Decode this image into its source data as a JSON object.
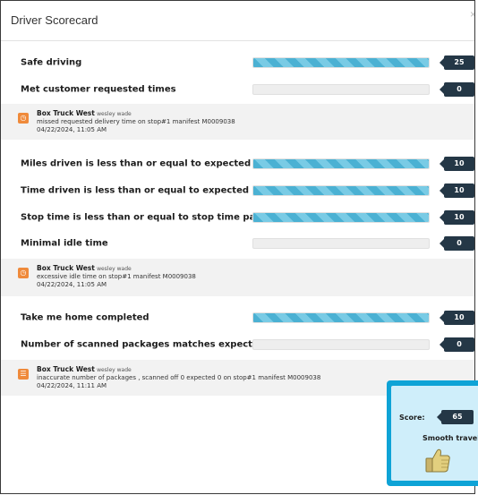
{
  "dialog": {
    "title": "Driver Scorecard",
    "close_glyph": "×"
  },
  "metrics": [
    {
      "label": "Safe driving",
      "value": "25",
      "fill": 1.0
    },
    {
      "label": "Met customer requested times",
      "value": "0",
      "fill": 0
    },
    {
      "label": "Miles driven is less than or equal to expected",
      "value": "10",
      "fill": 1.0
    },
    {
      "label": "Time driven is less than or equal to expected",
      "value": "10",
      "fill": 1.0
    },
    {
      "label": "Stop time is less than or equal to stop time padding",
      "value": "10",
      "fill": 1.0
    },
    {
      "label": "Minimal idle time",
      "value": "0",
      "fill": 0
    },
    {
      "label": "Take me home completed",
      "value": "10",
      "fill": 1.0
    },
    {
      "label": "Number of scanned packages matches expected",
      "value": "0",
      "fill": 0
    }
  ],
  "notes": [
    {
      "vehicle": "Box Truck West",
      "driver": "wesley wade",
      "message": "missed requested delivery time on stop#1 manifest M0009038",
      "timestamp": "04/22/2024, 11:05 AM",
      "icon": "clock-icon"
    },
    {
      "vehicle": "Box Truck West",
      "driver": "wesley wade",
      "message": "excessive idle time on stop#1 manifest M0009038",
      "timestamp": "04/22/2024, 11:05 AM",
      "icon": "clock-icon"
    },
    {
      "vehicle": "Box Truck West",
      "driver": "wesley wade",
      "message": "inaccurate number of packages , scanned off 0 expected 0 on stop#1 manifest M0009038",
      "timestamp": "04/22/2024, 11:11 AM",
      "icon": "list-icon"
    }
  ],
  "score": {
    "label": "Score:",
    "value": "65",
    "message": "Smooth travels",
    "icon": "thumbs-up-icon"
  },
  "colors": {
    "accent": "#0ea3d6",
    "badge": "#243746",
    "bar_fill": "#4bb1d3",
    "note_icon": "#ef8a3b"
  }
}
